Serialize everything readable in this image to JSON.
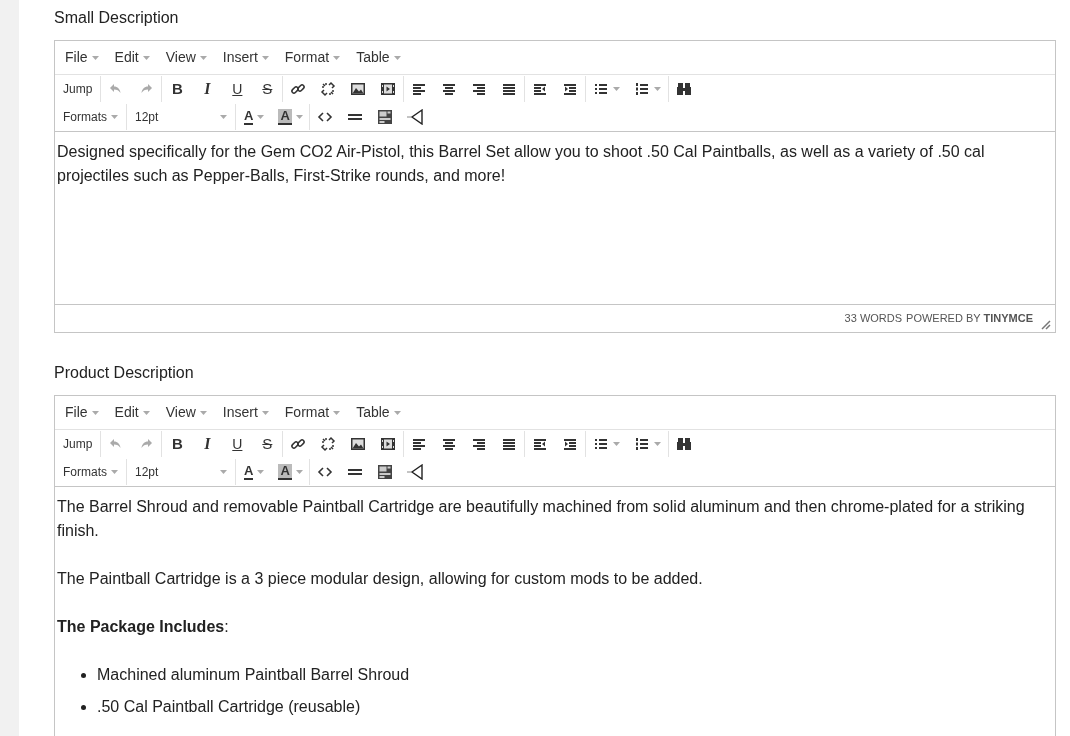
{
  "editors": [
    {
      "label": "Small Description",
      "menu": [
        "File",
        "Edit",
        "View",
        "Insert",
        "Format",
        "Table"
      ],
      "toolbar_rows": [
        [
          [
            {
              "kind": "text",
              "label": "Jump"
            }
          ],
          [
            {
              "kind": "undo",
              "disabled": true
            },
            {
              "kind": "redo",
              "disabled": true
            }
          ],
          [
            {
              "kind": "bold",
              "label": "B"
            },
            {
              "kind": "italic",
              "label": "I"
            },
            {
              "kind": "underline",
              "label": "U"
            },
            {
              "kind": "strike",
              "label": "S"
            }
          ],
          [
            {
              "kind": "link"
            },
            {
              "kind": "unlink"
            },
            {
              "kind": "image"
            },
            {
              "kind": "media"
            }
          ],
          [
            {
              "kind": "alignleft"
            },
            {
              "kind": "aligncenter"
            },
            {
              "kind": "alignright"
            },
            {
              "kind": "justify"
            }
          ],
          [
            {
              "kind": "outdent"
            },
            {
              "kind": "indent"
            }
          ],
          [
            {
              "kind": "bullets"
            },
            {
              "kind": "numbers"
            }
          ],
          [
            {
              "kind": "binoculars"
            }
          ]
        ],
        [
          [
            {
              "kind": "select",
              "label": "Formats"
            }
          ],
          [
            {
              "kind": "size",
              "label": "12pt"
            }
          ],
          [
            {
              "kind": "forecolor",
              "label": "A"
            },
            {
              "kind": "backcolor",
              "label": "A"
            }
          ],
          [
            {
              "kind": "code"
            },
            {
              "kind": "rule"
            },
            {
              "kind": "template"
            },
            {
              "kind": "direction"
            }
          ]
        ]
      ],
      "content": [
        {
          "kind": "p",
          "text": "Designed specifically for the Gem CO2 Air-Pistol, this Barrel Set allow you to shoot .50 Cal Paintballs, as well as a variety of .50 cal projectiles such as Pepper-Balls, First-Strike rounds, and more!"
        }
      ],
      "status_bar": {
        "word_count": "33 WORDS",
        "branding": "POWERED BY **TINYMCE**"
      }
    },
    {
      "label": "Product Description",
      "menu": [
        "File",
        "Edit",
        "View",
        "Insert",
        "Format",
        "Table"
      ],
      "toolbar_rows": [
        [
          [
            {
              "kind": "text",
              "label": "Jump"
            }
          ],
          [
            {
              "kind": "undo",
              "disabled": true
            },
            {
              "kind": "redo",
              "disabled": true
            }
          ],
          [
            {
              "kind": "bold",
              "label": "B"
            },
            {
              "kind": "italic",
              "label": "I"
            },
            {
              "kind": "underline",
              "label": "U"
            },
            {
              "kind": "strike",
              "label": "S"
            }
          ],
          [
            {
              "kind": "link"
            },
            {
              "kind": "unlink"
            },
            {
              "kind": "image"
            },
            {
              "kind": "media"
            }
          ],
          [
            {
              "kind": "alignleft"
            },
            {
              "kind": "aligncenter"
            },
            {
              "kind": "alignright"
            },
            {
              "kind": "justify"
            }
          ],
          [
            {
              "kind": "outdent"
            },
            {
              "kind": "indent"
            }
          ],
          [
            {
              "kind": "bullets"
            },
            {
              "kind": "numbers"
            }
          ],
          [
            {
              "kind": "binoculars"
            }
          ]
        ],
        [
          [
            {
              "kind": "select",
              "label": "Formats"
            }
          ],
          [
            {
              "kind": "size",
              "label": "12pt"
            }
          ],
          [
            {
              "kind": "forecolor",
              "label": "A"
            },
            {
              "kind": "backcolor",
              "label": "A"
            }
          ],
          [
            {
              "kind": "code"
            },
            {
              "kind": "rule"
            },
            {
              "kind": "template"
            },
            {
              "kind": "direction"
            }
          ]
        ]
      ],
      "content": [
        {
          "kind": "p",
          "text": "The Barrel Shroud and removable Paintball Cartridge are beautifully machined from solid aluminum and then chrome-plated for a striking finish."
        },
        {
          "kind": "p",
          "text": "The Paintball Cartridge is a 3 piece modular design, allowing for custom mods to be added."
        },
        {
          "kind": "p",
          "text": "**The Package Includes**:"
        },
        {
          "kind": "ul",
          "items": [
            "Machined aluminum Paintball Barrel Shroud",
            ".50 Cal Paintball Cartridge (reusable)"
          ]
        }
      ]
    }
  ]
}
